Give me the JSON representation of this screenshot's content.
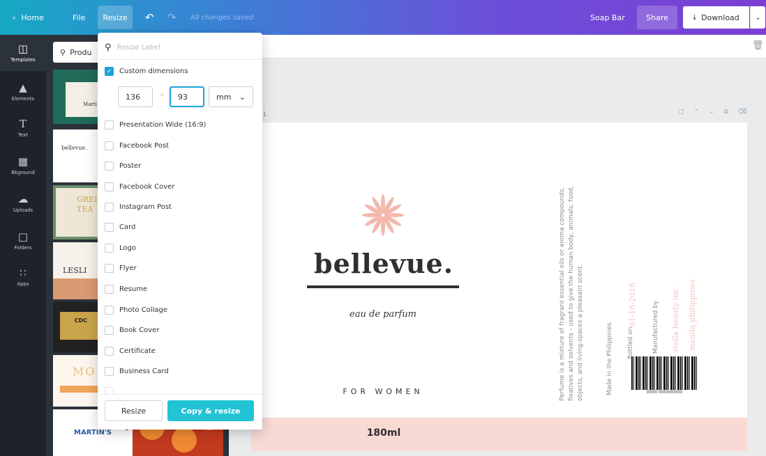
{
  "topbar": {
    "home": "Home",
    "file": "File",
    "resize": "Resize",
    "saved_status": "All changes saved",
    "design_name": "Soap Bar",
    "share": "Share",
    "download": "Download",
    "gradient": [
      "#16a9c4",
      "#6c4fd8",
      "#7b3fd4"
    ]
  },
  "sidebar": {
    "items": [
      {
        "label": "Templates",
        "icon": "templates-icon"
      },
      {
        "label": "Elements",
        "icon": "elements-icon"
      },
      {
        "label": "Text",
        "icon": "text-icon"
      },
      {
        "label": "Bkground",
        "icon": "background-icon"
      },
      {
        "label": "Uploads",
        "icon": "upload-icon"
      },
      {
        "label": "Folders",
        "icon": "folder-icon"
      },
      {
        "label": "Apps",
        "icon": "apps-icon"
      }
    ]
  },
  "template_panel": {
    "search_value": "Produ",
    "thumbnails": {
      "t1": "Marti",
      "t2": "bellevue.",
      "t3a": "GREI",
      "t3b": "TEA",
      "t4": "LESLI",
      "t5": "CDC",
      "t6": "MO",
      "t7": "MARTIN'S",
      "t7b": "1"
    }
  },
  "resize_menu": {
    "search_placeholder": "Resize Label",
    "custom_label": "Custom dimensions",
    "custom_checked": true,
    "width": "136",
    "height": "93",
    "unit": "mm",
    "options": [
      "Presentation Wide (16:9)",
      "Facebook Post",
      "Poster",
      "Facebook Cover",
      "Instagram Post",
      "Card",
      "Logo",
      "Flyer",
      "Resume",
      "Photo Collage",
      "Book Cover",
      "Certificate",
      "Business Card"
    ],
    "resize_button": "Resize",
    "copy_resize_button": "Copy & resize",
    "accent": "#1ca3d8",
    "primary_button_color": "#22c3d4"
  },
  "canvas": {
    "page_label": "e 1",
    "brand": "bellevue.",
    "subtitle": "eau de parfum",
    "for_women": "FOR WOMEN",
    "volume": "180ml",
    "description_1": "Perfume is a mixture of fragrant essential oils or aroma compounds,",
    "description_2": "fixatives and solvents - used to give the human body, animals, food,",
    "description_3": "objects, and living-spaces a pleasant scent.",
    "made_in": "Made in the Philippines.",
    "bottled_on_label": "Bottled on",
    "bottled_on_date": "01-16-2018",
    "manufactured_by_label": "Manufactured by",
    "manufacturer": "stella beauty inc.",
    "location": "manila philippines",
    "barcode_number": "0000 000000000",
    "band_color": "#f8d9d3"
  }
}
